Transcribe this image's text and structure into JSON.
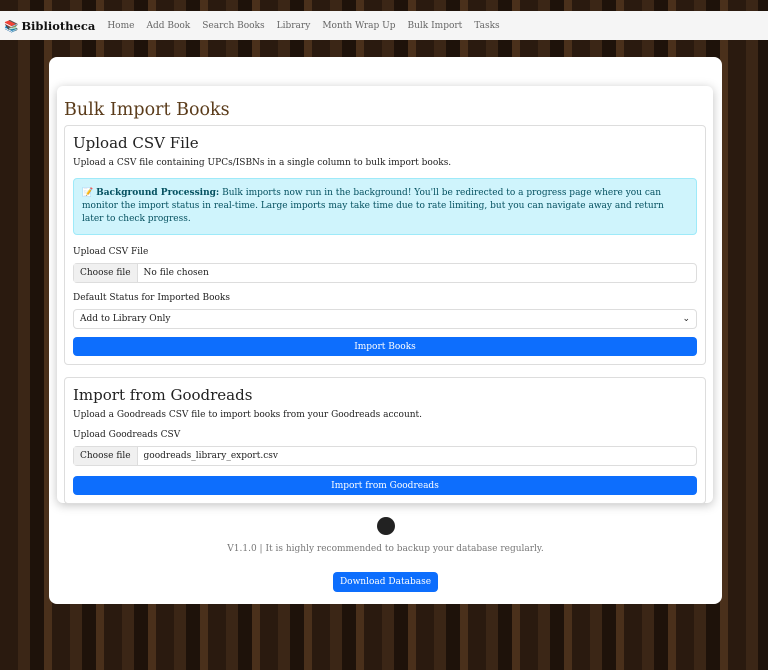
{
  "nav": {
    "brand": "Bibliotheca",
    "links": [
      "Home",
      "Add Book",
      "Search Books",
      "Library",
      "Month Wrap Up",
      "Bulk Import",
      "Tasks"
    ]
  },
  "page_title": "Bulk Import Books",
  "csv": {
    "title": "Upload CSV File",
    "desc": "Upload a CSV file containing UPCs/ISBNs in a single column to bulk import books.",
    "alert_bold": "Background Processing:",
    "alert_text": " Bulk imports now run in the background! You'll be redirected to a progress page where you can monitor the import status in real-time. Large imports may take time due to rate limiting, but you can navigate away and return later to check progress.",
    "file_label": "Upload CSV File",
    "choose": "Choose file",
    "file_value": "No file chosen",
    "status_label": "Default Status for Imported Books",
    "status_value": "Add to Library Only",
    "button": "Import Books"
  },
  "goodreads": {
    "title": "Import from Goodreads",
    "desc": "Upload a Goodreads CSV file to import books from your Goodreads account.",
    "file_label": "Upload Goodreads CSV",
    "choose": "Choose file",
    "file_value": "goodreads_library_export.csv",
    "button": "Import from Goodreads"
  },
  "footer": {
    "text": "V1.1.0 | It is highly recommended to backup your database regularly.",
    "download": "Download Database"
  }
}
